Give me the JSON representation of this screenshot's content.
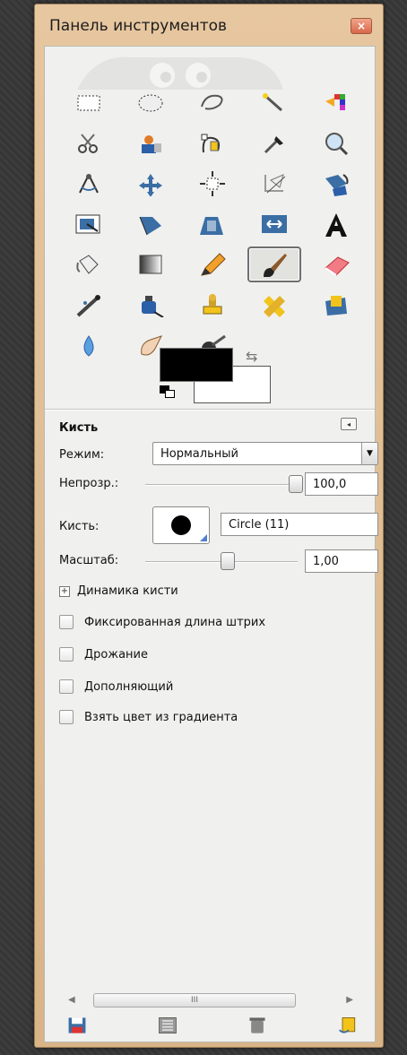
{
  "window": {
    "title": "Панель инструментов",
    "close_glyph": "×"
  },
  "tools": [
    {
      "name": "rect-select-icon"
    },
    {
      "name": "ellipse-select-icon"
    },
    {
      "name": "free-select-icon"
    },
    {
      "name": "fuzzy-select-icon"
    },
    {
      "name": "select-by-color-icon"
    },
    {
      "name": "scissors-select-icon"
    },
    {
      "name": "foreground-select-icon"
    },
    {
      "name": "paths-icon"
    },
    {
      "name": "color-picker-icon"
    },
    {
      "name": "zoom-icon"
    },
    {
      "name": "measure-icon"
    },
    {
      "name": "move-icon"
    },
    {
      "name": "align-icon"
    },
    {
      "name": "crop-icon"
    },
    {
      "name": "rotate-icon"
    },
    {
      "name": "scale-icon"
    },
    {
      "name": "shear-icon"
    },
    {
      "name": "perspective-icon"
    },
    {
      "name": "flip-icon"
    },
    {
      "name": "text-icon"
    },
    {
      "name": "bucket-fill-icon"
    },
    {
      "name": "blend-icon"
    },
    {
      "name": "pencil-icon"
    },
    {
      "name": "paintbrush-icon",
      "active": true
    },
    {
      "name": "eraser-icon"
    },
    {
      "name": "airbrush-icon"
    },
    {
      "name": "ink-icon"
    },
    {
      "name": "clone-icon"
    },
    {
      "name": "heal-icon"
    },
    {
      "name": "perspective-clone-icon"
    },
    {
      "name": "blur-sharpen-icon"
    },
    {
      "name": "smudge-icon"
    },
    {
      "name": "dodge-burn-icon"
    }
  ],
  "colors": {
    "foreground": "#000000",
    "background": "#ffffff"
  },
  "options": {
    "heading": "Кисть",
    "mode_label": "Режим:",
    "mode_value": "Нормальный",
    "opacity_label": "Непрозр.:",
    "opacity_value": "100,0",
    "opacity_fraction": 1.0,
    "brush_label": "Кисть:",
    "brush_value": "Circle (11)",
    "scale_label": "Масштаб:",
    "scale_value": "1,00",
    "dynamics_label": "Динамика кисти",
    "checkboxes": [
      "Фиксированная длина штрих",
      "Дрожание",
      "Дополняющий",
      "Взять цвет из градиента"
    ]
  },
  "scrollbar": {
    "thumb_label": "III"
  },
  "bottom_actions": [
    {
      "name": "save-options-icon"
    },
    {
      "name": "restore-options-icon"
    },
    {
      "name": "delete-options-icon"
    },
    {
      "name": "reset-options-icon"
    }
  ]
}
